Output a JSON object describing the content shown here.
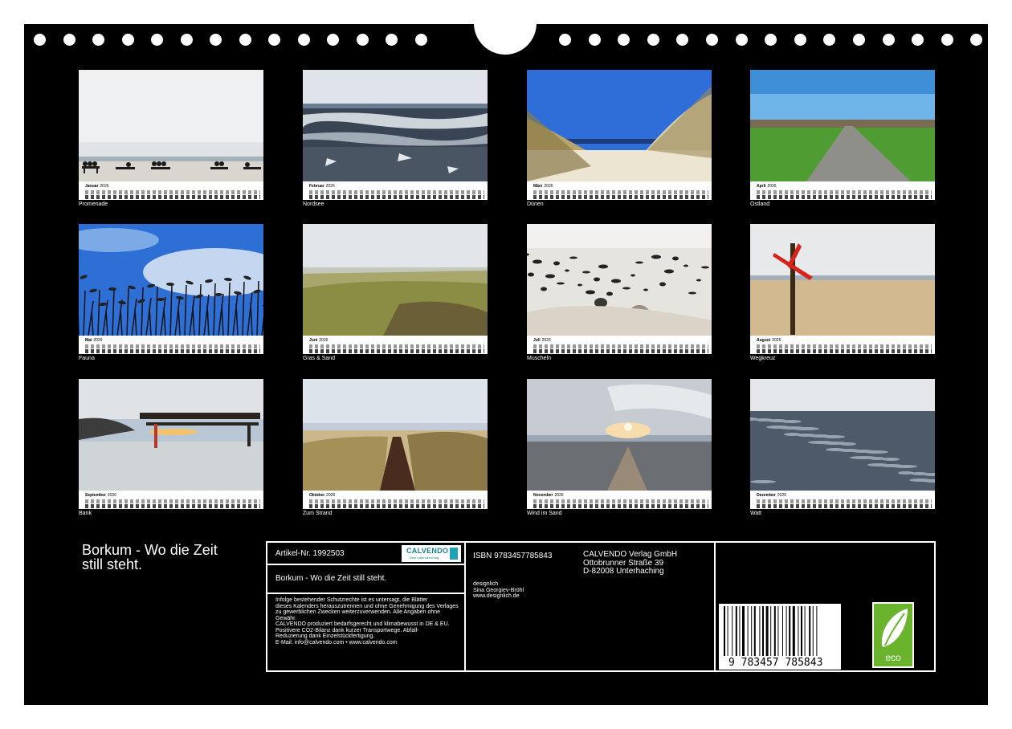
{
  "months": [
    {
      "name": "Januar",
      "year": "2026",
      "caption": "Promenade",
      "icon": "photo-promenade-benches"
    },
    {
      "name": "Februar",
      "year": "2026",
      "caption": "Nordsee",
      "icon": "photo-sea-waves"
    },
    {
      "name": "März",
      "year": "2026",
      "caption": "Dünen",
      "icon": "photo-dunes"
    },
    {
      "name": "April",
      "year": "2026",
      "caption": "Ostland",
      "icon": "photo-path-green"
    },
    {
      "name": "Mai",
      "year": "2026",
      "caption": "Fauna",
      "icon": "photo-reeds-sky"
    },
    {
      "name": "Juni",
      "year": "2026",
      "caption": "Gras & Sand",
      "icon": "photo-grass-dunes"
    },
    {
      "name": "Juli",
      "year": "2026",
      "caption": "Muscheln",
      "icon": "photo-shells-sand"
    },
    {
      "name": "August",
      "year": "2026",
      "caption": "Wegkreuz",
      "icon": "photo-post-beach"
    },
    {
      "name": "September",
      "year": "2026",
      "caption": "Bank",
      "icon": "photo-bench-sunset"
    },
    {
      "name": "Oktober",
      "year": "2026",
      "caption": "Zum Strand",
      "icon": "photo-boardwalk"
    },
    {
      "name": "November",
      "year": "2026",
      "caption": "Wind im Sand",
      "icon": "photo-sunset-beach"
    },
    {
      "name": "Dezember",
      "year": "2026",
      "caption": "Watt",
      "icon": "photo-mudflat"
    }
  ],
  "back_cover": {
    "title_line1": "Borkum - Wo die Zeit",
    "title_line2": "still steht.",
    "article_no": "Artikel-Nr. 1992503",
    "logo_text": "CALVENDO",
    "logo_sub": "Dein Kalenderverlag",
    "subtitle": "Borkum - Wo die Zeit still steht.",
    "legal_lines": [
      "Infolge bestehender Schutzrechte ist es untersagt, die Blätter",
      "dieses Kalenders herauszutrennen und ohne Genehmigung des Verlages",
      "zu gewerblichen Zwecken weiterzuverwenden. Alle Angaben ohne",
      "Gewähr.",
      "CALVENDO produziert bedarfsgerecht und klimabewusst in DE & EU.",
      "Positivere CO2-Bilanz dank kurzer Transportwege. Abfall-",
      "Reduzierung dank Einzelstückfertigung.",
      "E-Mail: info@calvendo.com • www.calvendo.com"
    ],
    "isbn": "ISBN 9783457785843",
    "publisher_lines": [
      "CALVENDO Verlag GmbH",
      "Ottobrunner Straße 39",
      "D-82008 Unterhaching"
    ],
    "author_lines": [
      "designlich",
      "Sina Georgiev-Bröhl",
      "www.designlich.de"
    ],
    "barcode_number": "9 783457 785843",
    "eco_label": "eco"
  },
  "colors": {
    "background": "#000000",
    "text": "#ffffff",
    "calvendo_teal": "#1a7f8e",
    "eco_green": "#6ab42d"
  }
}
